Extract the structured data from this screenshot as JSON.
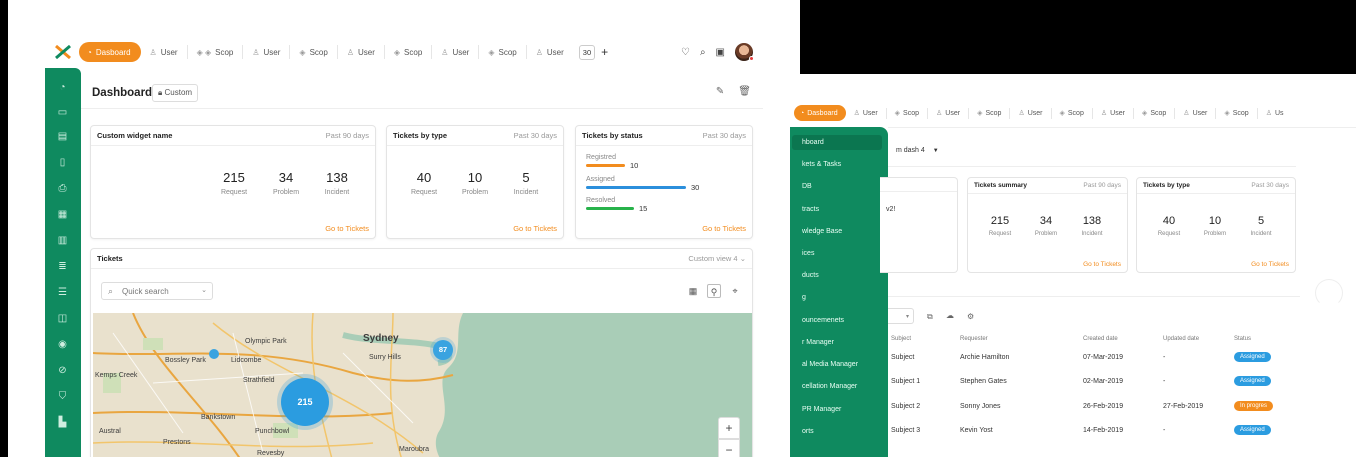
{
  "front": {
    "tabs": {
      "dashboard": "Dasboard",
      "items": [
        "User",
        "Scop",
        "User",
        "Scop",
        "User",
        "Scop",
        "User",
        "Scop",
        "User"
      ],
      "count": "30",
      "add": "+"
    },
    "page_title": "Dashboard",
    "custom_chip": "Custom",
    "widgets": {
      "custom": {
        "title": "Custom widget name",
        "period": "Past 90 days",
        "stats": [
          {
            "value": "215",
            "label": "Request"
          },
          {
            "value": "34",
            "label": "Problem"
          },
          {
            "value": "138",
            "label": "Incident"
          }
        ],
        "link": "Go to Tickets"
      },
      "by_type": {
        "title": "Tickets by type",
        "period": "Past 30 days",
        "stats": [
          {
            "value": "40",
            "label": "Request"
          },
          {
            "value": "10",
            "label": "Problem"
          },
          {
            "value": "5",
            "label": "Incident"
          }
        ],
        "link": "Go to Tickets"
      },
      "by_status": {
        "title": "Tickets by status",
        "period": "Past 30 days",
        "rows": [
          {
            "label": "Registred",
            "value": "10",
            "color": "#f28c1e",
            "fraction": 0.39
          },
          {
            "label": "Assigned",
            "value": "30",
            "color": "#2b8fdc",
            "fraction": 1.0
          },
          {
            "label": "Resolved",
            "value": "15",
            "color": "#27b24a",
            "fraction": 0.48
          }
        ],
        "link": "Go to Tickets"
      }
    },
    "tickets": {
      "title": "Tickets",
      "view": "Custom view 4",
      "search_placeholder": "Quick search",
      "map": {
        "labels": [
          "Kemps Creek",
          "Bossley Park",
          "Lidcombe",
          "Olympic Park",
          "Strathfield",
          "Bankstown",
          "Sydney",
          "Surry Hills",
          "Punchbowl",
          "Prestons",
          "Maroubra",
          "Austral",
          "Revesby"
        ],
        "clusters": [
          {
            "value": "215",
            "color": "#2b9ce0"
          },
          {
            "value": "87",
            "color": "#3aa3e0"
          }
        ],
        "zoom_in": "+",
        "zoom_out": "−"
      }
    }
  },
  "back": {
    "tabs": {
      "dashboard": "Dasboard",
      "items": [
        "User",
        "Scop",
        "User",
        "Scop",
        "User",
        "Scop",
        "User",
        "Scop",
        "User",
        "Scop",
        "Us"
      ]
    },
    "sidebar_items": [
      "hboard",
      "kets & Tasks",
      "DB",
      "tracts",
      "wledge Base",
      "ices",
      "ducts",
      "g",
      "ouncemenets",
      "r Manager",
      "al Media Manager",
      "cellation Manager",
      "PR Manager",
      "orts"
    ],
    "dash_select": "m dash 4",
    "widgets": {
      "custom_text": "v2!",
      "summary": {
        "title": "Tickets summary",
        "period": "Past 90 days",
        "stats": [
          {
            "value": "215",
            "label": "Request"
          },
          {
            "value": "34",
            "label": "Problem"
          },
          {
            "value": "138",
            "label": "Incident"
          }
        ],
        "link": "Go to Tickets"
      },
      "by_type": {
        "title": "Tickets by type",
        "period": "Past 30 days",
        "stats": [
          {
            "value": "40",
            "label": "Request"
          },
          {
            "value": "10",
            "label": "Problem"
          },
          {
            "value": "5",
            "label": "Incident"
          }
        ],
        "link": "Go to Tickets"
      }
    },
    "table": {
      "headers": [
        "Subject",
        "Requester",
        "Created date",
        "Updated date",
        "Status"
      ],
      "rows": [
        {
          "subject": "Subject",
          "requester": "Archie Hamilton",
          "created": "07-Mar-2019",
          "updated": "-",
          "status": "Assigned",
          "status_color": "#2b9ce0"
        },
        {
          "subject": "Subject 1",
          "requester": "Stephen Gates",
          "created": "02-Mar-2019",
          "updated": "-",
          "status": "Assigned",
          "status_color": "#2b9ce0"
        },
        {
          "subject": "Subject 2",
          "requester": "Sonny Jones",
          "created": "26-Feb-2019",
          "updated": "27-Feb-2019",
          "status": "In progres",
          "status_color": "#f28c1e"
        },
        {
          "subject": "Subject 3",
          "requester": "Kevin Yost",
          "created": "14-Feb-2019",
          "updated": "-",
          "status": "Assigned",
          "status_color": "#2b9ce0"
        }
      ]
    }
  }
}
